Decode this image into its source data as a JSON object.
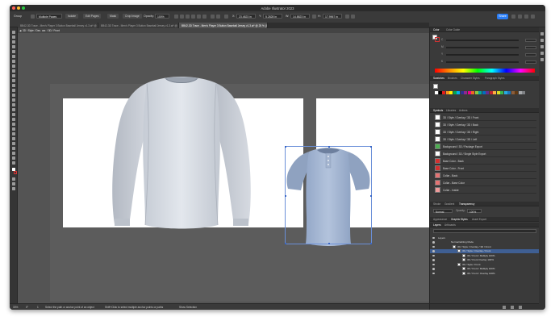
{
  "window": {
    "title": "Adobe Illustrator 2023"
  },
  "controlbar": {
    "group_label": "Group",
    "dropdown_value": "Multiple Pages",
    "btn_isolate": "Isolate",
    "btn_edit_pages": "Edit Pages",
    "btn_mask": "Mask",
    "btn_crop_image": "Crop Image",
    "opacity_label": "Opacity:",
    "opacity_value": "100%",
    "x_value": "23.4823 in",
    "y_value": "5.2828 in",
    "w_value": "14.8823 in",
    "h_value": "17.9967 in",
    "share_label": "Share"
  },
  "doc_tabs": [
    "BB42-3D Trace - Men's Player 3 Button Baseball Jersey v1.3.ai* @ 33.33 % (CMYK/Preview)",
    "BB42-3D Trace - Men's Player 3 Button Baseball Jersey v1.3.ai* @ 16.67 % (CMYK/Preview)",
    "BB42-3D Trace - Men's Player 3 Button Baseball Jersey v1.3.ai* @ 25 % (CMYK/Preview)"
  ],
  "breadcrumb": {
    "text": "3D / Style / Dec. car. / 3D / Front"
  },
  "statusbar": {
    "zoom": "33%",
    "angle": "0°",
    "artboard_num": "1",
    "hint": "Select the path or anchor point of an object",
    "hint2": "Shift+Click to select multiple anchor points or paths",
    "mode": "Show Selection"
  },
  "panels": {
    "color": {
      "tabs": [
        "Color",
        "Color Guide"
      ],
      "channels": [
        "C",
        "M",
        "Y",
        "K"
      ]
    },
    "swatches": {
      "tabs": [
        "Swatches",
        "Brushes",
        "Character Styles",
        "Paragraph Styles"
      ],
      "colors": [
        "#ffffff",
        "#000000",
        "#e21b1b",
        "#f7941d",
        "#fff200",
        "#00a651",
        "#00aeef",
        "#2e3192",
        "#92278f",
        "#ec008c",
        "#f26522",
        "#8dc63f",
        "#00a99d",
        "#0072bc",
        "#662d91",
        "#c1272d",
        "#fbb040",
        "#d7df23",
        "#39b54a",
        "#27aae1",
        "#1c75bc",
        "#8a5d3b",
        "#603913",
        "#a7a9ac",
        "#808285"
      ]
    },
    "symbols": {
      "tabs": [
        "Symbols",
        "Libraries",
        "Actions"
      ],
      "items": [
        "3D / Style / Overlay / 3D / Front",
        "3D / Style / Overlay / 3D / Back",
        "3D / Style / Overlay / 3D / Right",
        "3D / Style / Overlay / 3D / Left",
        "Background / 3D / Package Export",
        "Background / 3D / Single Style Export",
        "Base Color - Back",
        "Base Color - Front",
        "Collar - Back",
        "Collar - Base Color",
        "Collar - Inside"
      ]
    },
    "transparency": {
      "tabs": [
        "Stroke",
        "Gradient",
        "Transparency"
      ],
      "blend_mode": "Normal",
      "opacity_label": "Opacity:",
      "opacity_value": "100%"
    },
    "graphic_styles": {
      "tabs": [
        "Appearance",
        "Graphic Styles",
        "Asset Export"
      ]
    },
    "layers": {
      "tabs": [
        "Layers",
        "Artboards"
      ],
      "rows": [
        "Layers",
        "Normal Editing Mode",
        "3D / Style / Overlay / 3D / Front",
        "3D / Style / Overlay / Front",
        "3D / Front / Multiply 100%",
        "3D / Front Overlay 100%",
        "3D / Style / Front",
        "3D / Front / Multiply 100%",
        "3D / Front / Overlay 100%"
      ]
    }
  }
}
